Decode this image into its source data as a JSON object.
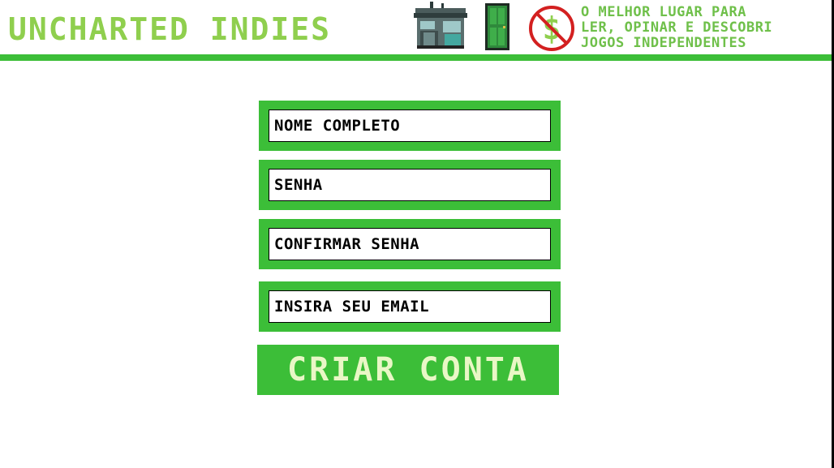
{
  "header": {
    "logo_text": "UNCHARTED INDIES",
    "tagline": [
      "O MELHOR LUGAR PARA",
      "LER, OPINAR E DESCOBRI",
      "JOGOS INDEPENDENTES"
    ],
    "icons": [
      "shop-icon",
      "door-icon",
      "no-money-icon"
    ]
  },
  "form": {
    "fields": [
      {
        "name": "full-name-field",
        "placeholder": "NOME COMPLETO"
      },
      {
        "name": "password-field",
        "placeholder": "SENHA"
      },
      {
        "name": "confirm-password-field",
        "placeholder": "CONFIRMAR SENHA"
      },
      {
        "name": "email-field",
        "placeholder": "INSIRA SEU EMAIL"
      }
    ],
    "submit_label": "CRIAR CONTA"
  },
  "colors": {
    "accent_green": "#3cbe38",
    "logo_green": "#8fcf4e",
    "button_text": "#e9f7c6"
  }
}
